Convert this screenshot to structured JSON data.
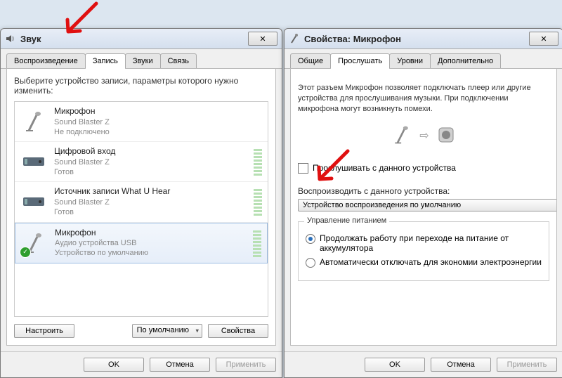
{
  "win_sound": {
    "title": "Звук",
    "tabs": [
      "Воспроизведение",
      "Запись",
      "Звуки",
      "Связь"
    ],
    "active_tab": 1,
    "instruction": "Выберите устройство записи, параметры которого нужно изменить:",
    "devices": [
      {
        "name": "Микрофон",
        "sub1": "Sound Blaster Z",
        "sub2": "Не подключено",
        "icon": "mic"
      },
      {
        "name": "Цифровой вход",
        "sub1": "Sound Blaster Z",
        "sub2": "Готов",
        "icon": "soundcard"
      },
      {
        "name": "Источник записи What U Hear",
        "sub1": "Sound Blaster Z",
        "sub2": "Готов",
        "icon": "soundcard"
      },
      {
        "name": "Микрофон",
        "sub1": "Аудио устройства USB",
        "sub2": "Устройство по умолчанию",
        "icon": "mic",
        "default": true
      }
    ],
    "btn_configure": "Настроить",
    "dd_default": "По умолчанию",
    "btn_properties": "Свойства",
    "btn_ok": "OK",
    "btn_cancel": "Отмена",
    "btn_apply": "Применить"
  },
  "win_props": {
    "title": "Свойства: Микрофон",
    "tabs": [
      "Общие",
      "Прослушать",
      "Уровни",
      "Дополнительно"
    ],
    "active_tab": 1,
    "description": "Этот разъем Микрофон позволяет подключать плеер или другие устройства для прослушивания музыки. При подключении микрофона могут возникнуть помехи.",
    "listen_label": "Прослушивать с данного устройства",
    "listen_checked": false,
    "playthrough_label": "Воспроизводить с данного устройства:",
    "playthrough_value": "Устройство воспроизведения по умолчанию",
    "power_group": "Управление питанием",
    "radio1": "Продолжать работу при переходе на питание от аккумулятора",
    "radio2": "Автоматически отключать для экономии электроэнергии",
    "radio_selected": 0,
    "btn_ok": "OK",
    "btn_cancel": "Отмена",
    "btn_apply": "Применить"
  }
}
